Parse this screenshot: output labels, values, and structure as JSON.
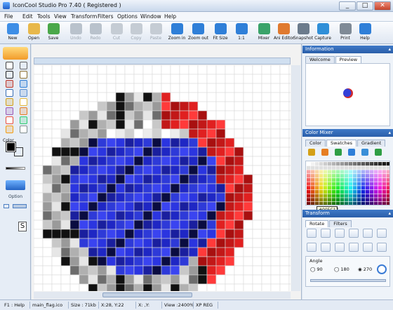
{
  "window": {
    "title": "IconCool Studio Pro 7.40 ( Registered )",
    "minimize_label": "_",
    "maximize_label": "□",
    "close_label": "✕"
  },
  "menu": [
    "File",
    "Edit",
    "Tools",
    "View",
    "Transform",
    "Filters",
    "Options",
    "Window",
    "Help"
  ],
  "toolbar": [
    {
      "label": "New",
      "icon": "new-file-icon",
      "color": "#3e8ee6",
      "enabled": true
    },
    {
      "label": "Open",
      "icon": "open-folder-icon",
      "color": "#e8b84a",
      "enabled": true
    },
    {
      "label": "Save",
      "icon": "save-disk-icon",
      "color": "#4aa84a",
      "enabled": true
    },
    {
      "label": "Undo",
      "icon": "undo-icon",
      "color": "#b9c2cc",
      "enabled": false
    },
    {
      "label": "Redo",
      "icon": "redo-icon",
      "color": "#b9c2cc",
      "enabled": false
    },
    {
      "label": "Cut",
      "icon": "cut-icon",
      "color": "#c5ccd4",
      "enabled": false
    },
    {
      "label": "Copy",
      "icon": "copy-icon",
      "color": "#c5ccd4",
      "enabled": false
    },
    {
      "label": "Paste",
      "icon": "paste-icon",
      "color": "#c5ccd4",
      "enabled": false
    },
    {
      "label": "Zoom in",
      "icon": "zoom-in-icon",
      "color": "#2f7fd8",
      "enabled": true
    },
    {
      "label": "Zoom out",
      "icon": "zoom-out-icon",
      "color": "#2f7fd8",
      "enabled": true
    },
    {
      "label": "Fit Size",
      "icon": "fit-size-icon",
      "color": "#2f7fd8",
      "enabled": true
    },
    {
      "label": "1:1",
      "icon": "actual-size-icon",
      "color": "#2f7fd8",
      "enabled": true
    },
    {
      "label": "Mixer",
      "icon": "mixer-icon",
      "color": "#3aa36a",
      "enabled": true
    },
    {
      "label": "Ani Editor",
      "icon": "animation-editor-icon",
      "color": "#e07a2f",
      "enabled": true
    },
    {
      "label": "Snapshot",
      "icon": "camera-icon",
      "color": "#6b7b8c",
      "enabled": true
    },
    {
      "label": "Capture",
      "icon": "capture-icon",
      "color": "#2f8fd8",
      "enabled": true
    },
    {
      "label": "Print",
      "icon": "printer-icon",
      "color": "#7f8a96",
      "enabled": true
    },
    {
      "label": "Help",
      "icon": "help-icon",
      "color": "#2f7fd8",
      "enabled": true
    }
  ],
  "left_tools": {
    "color_label": "Color",
    "option_label": "Option"
  },
  "palette_colors": {
    "foreground": "#000000",
    "background": "#ffffff"
  },
  "information": {
    "header": "Information",
    "tabs": [
      "Welcome",
      "Preview"
    ],
    "active_tab": "Preview"
  },
  "color_mixer": {
    "header": "Color Mixer",
    "tabs": [
      "Color",
      "Swatches",
      "Gradient"
    ],
    "active_tab": "Swatches",
    "tooltip": "#005C17"
  },
  "transform": {
    "header": "Transform",
    "tabs": [
      "Rotate",
      "Filters"
    ],
    "active_tab": "Rotate",
    "angle_label": "Angle",
    "angles": [
      "90",
      "180",
      "270"
    ],
    "selected_angle": "270"
  },
  "status": {
    "help": "F1 : Help",
    "file": "main_flag.ico",
    "size": "Size : 71kb",
    "coords": "X:28, Y:22",
    "xy": "X: ,Y:",
    "view": "View :2400%",
    "regime": "XP REG"
  }
}
